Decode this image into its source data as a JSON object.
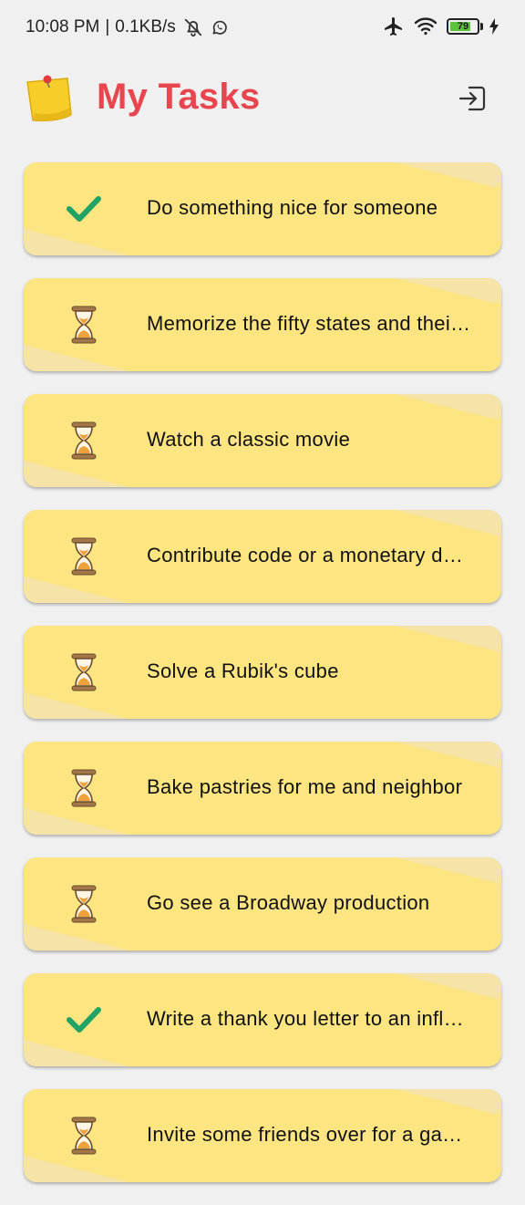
{
  "status_bar": {
    "time": "10:08 PM",
    "separator": "|",
    "network_speed": "0.1KB/s",
    "battery_level": "79",
    "battery_fraction": 0.79,
    "icons": [
      "bell-off-icon",
      "whatsapp-icon",
      "airplane-icon",
      "wifi-icon",
      "battery-icon",
      "charging-icon"
    ]
  },
  "header": {
    "title": "My Tasks",
    "logo_icon": "sticky-note-icon",
    "action_icon": "logout-icon"
  },
  "colors": {
    "title": "#e8454f",
    "card": "#fde581",
    "card_accent": "#f5e3a8",
    "done": "#21a366",
    "background": "#f0f0f0"
  },
  "tasks": [
    {
      "title": "Do something nice for someone",
      "status": "done",
      "icon": "checkmark-icon"
    },
    {
      "title": "Memorize the fifty states and their capitals",
      "status": "pending",
      "icon": "hourglass-icon"
    },
    {
      "title": "Watch a classic movie",
      "status": "pending",
      "icon": "hourglass-icon"
    },
    {
      "title": "Contribute code or a monetary donation",
      "status": "pending",
      "icon": "hourglass-icon"
    },
    {
      "title": "Solve a Rubik's cube",
      "status": "pending",
      "icon": "hourglass-icon"
    },
    {
      "title": "Bake pastries for me and neighbor",
      "status": "pending",
      "icon": "hourglass-icon"
    },
    {
      "title": "Go see a Broadway production",
      "status": "pending",
      "icon": "hourglass-icon"
    },
    {
      "title": "Write a thank you letter to an influential person",
      "status": "done",
      "icon": "checkmark-icon"
    },
    {
      "title": "Invite some friends over for a game night",
      "status": "pending",
      "icon": "hourglass-icon"
    }
  ]
}
